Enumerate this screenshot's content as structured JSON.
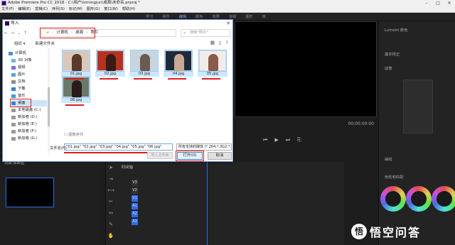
{
  "app": {
    "title": "Adobe Premiere Pro CC 2018 - C:\\用户\\lvmingjun\\桌面\\未命名.prproj *",
    "menu": [
      "文件(F)",
      "编辑(E)",
      "剪辑(C)",
      "序列(S)",
      "标记(M)",
      "图形(G)",
      "窗口(W)",
      "帮助(H)"
    ],
    "workspace_tabs": [
      "学习",
      "组件",
      "编辑",
      "颜色",
      "效果",
      "音频",
      "图形",
      "库"
    ],
    "program_timecode": "00:00:00:00",
    "lumetri_headers": [
      "Lumetri 颜色",
      "基本校正",
      "创意",
      "曲线",
      "色轮和匹配"
    ],
    "project_label": "项目:未命名",
    "sequence_label": "时间轴",
    "tracks": [
      "V3",
      "V2",
      "V1",
      "A1",
      "A2",
      "A3"
    ]
  },
  "dialog": {
    "title": "导入",
    "path": [
      "计算机",
      "桌面",
      "照片"
    ],
    "search_placeholder": "搜索\"照片\"",
    "organize": "组织 ▾",
    "new_folder": "新建文件夹",
    "sidebar": [
      {
        "label": "计算机",
        "icon": "computer-icon"
      },
      {
        "label": "3D 对象",
        "icon": "cube-icon"
      },
      {
        "label": "视频",
        "icon": "video-icon"
      },
      {
        "label": "图片",
        "icon": "picture-icon"
      },
      {
        "label": "文档",
        "icon": "document-icon"
      },
      {
        "label": "下载",
        "icon": "download-icon"
      },
      {
        "label": "音乐",
        "icon": "music-icon"
      },
      {
        "label": "桌面",
        "icon": "desktop-icon",
        "selected": true
      },
      {
        "label": "本地磁盘 (C:)",
        "icon": "disk-icon"
      },
      {
        "label": "新加卷 (D:)",
        "icon": "disk-icon"
      },
      {
        "label": "新加卷 (E:)",
        "icon": "disk-icon"
      },
      {
        "label": "新加卷 (F:)",
        "icon": "disk-icon"
      },
      {
        "label": "新加卷 (G:)",
        "icon": "disk-icon"
      }
    ],
    "files": [
      "01.jpg",
      "02.jpg",
      "03.jpg",
      "04.jpg",
      "05.jpg",
      "06.jpg"
    ],
    "image_sequence_label": "图像序列",
    "filename_label": "文件名(N):",
    "filename_value": "\"01.jpg\" \"02.jpg\" \"03.jpg\" \"04.jpg\" \"05.jpg\" \"06.jpg\"",
    "filetype_value": "所有支持的媒体 (*.264;*.3G2;*.",
    "import_folder": "导入文件夹",
    "open": "打开(O)",
    "cancel": "取消"
  },
  "watermark": {
    "text": "悟空问答",
    "logo": "悟"
  }
}
